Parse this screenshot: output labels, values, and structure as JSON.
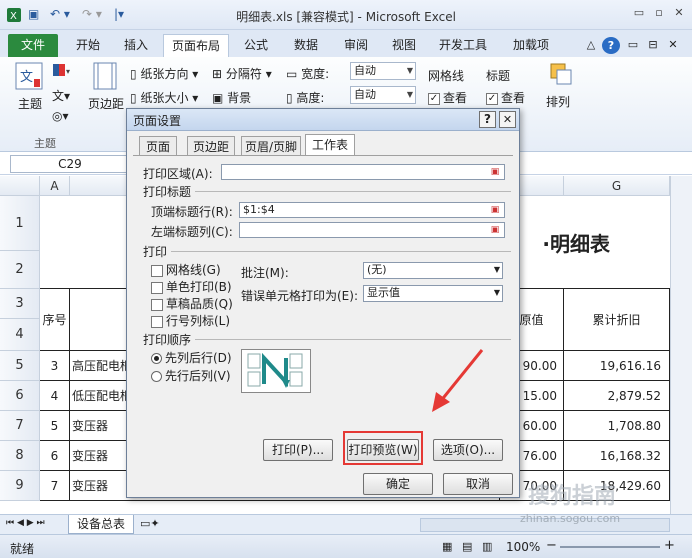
{
  "window": {
    "title": "明细表.xls  [兼容模式]  -  Microsoft Excel",
    "min": "▭",
    "max": "▫",
    "close": "✕"
  },
  "qat": {
    "save": "▣",
    "undo": "↶ ▾",
    "redo": "↷ ▾",
    "customize": "|▾"
  },
  "tabs": [
    "文件",
    "开始",
    "插入",
    "页面布局",
    "公式",
    "数据",
    "审阅",
    "视图",
    "开发工具",
    "加载项"
  ],
  "tabs_right": {
    "collapse": "△",
    "help": "?",
    "restore": "▭",
    "mdi_min": "⊟",
    "mdi_close": "✕"
  },
  "ribbon": {
    "themes_label": "主题",
    "themes_group": "主题",
    "margins_label": "页边距",
    "orientation": "纸张方向",
    "size": "纸张大小",
    "breaks": "分隔符",
    "background": "背景",
    "width_label": "宽度:",
    "width_value": "自动",
    "height_label": "高度:",
    "height_value": "自动",
    "gridlines_label": "网格线",
    "gridlines_view": "查看",
    "headings_label": "标题",
    "headings_view": "查看",
    "arrange_label": "排列"
  },
  "formula_bar": {
    "name_box": "C29"
  },
  "grid": {
    "col_headers": [
      "A",
      "G"
    ],
    "row_numbers": [
      "1",
      "2",
      "3",
      "4",
      "5",
      "6",
      "7",
      "8",
      "9"
    ],
    "title_fragment": "·明细表",
    "header_no": "序号",
    "header_value_fragment": "原值",
    "header_accum": "累计折旧",
    "rows": [
      {
        "no": "3",
        "name": "高压配电柜",
        "value": "90.00",
        "accum": "19,616.16"
      },
      {
        "no": "4",
        "name": "低压配电柜",
        "value": "15.00",
        "accum": "2,879.52"
      },
      {
        "no": "5",
        "name": "变压器",
        "value": "60.00",
        "accum": "1,708.80"
      },
      {
        "no": "6",
        "name": "变压器",
        "value": "76.00",
        "accum": "16,168.32"
      },
      {
        "no": "7",
        "name": "变压器",
        "value": "70.00",
        "accum": "18,429.60"
      }
    ]
  },
  "sheet_tabs": {
    "active": "设备总表",
    "nav": "⏮ ◀ ▶ ⏭"
  },
  "status": {
    "ready": "就绪",
    "zoom": "100%",
    "minus": "−",
    "plus": "+"
  },
  "dialog": {
    "title": "页面设置",
    "help": "?",
    "close": "✕",
    "tabs": [
      "页面",
      "页边距",
      "页眉/页脚",
      "工作表"
    ],
    "print_area_label": "打印区域(A):",
    "print_area_value": "",
    "print_titles_section": "打印标题",
    "rows_repeat_label": "顶端标题行(R):",
    "rows_repeat_value": "$1:$4",
    "cols_repeat_label": "左端标题列(C):",
    "cols_repeat_value": "",
    "print_section": "打印",
    "gridlines": "网格线(G)",
    "bw": "单色打印(B)",
    "draft": "草稿品质(Q)",
    "rowcol_headings": "行号列标(L)",
    "comments_label": "批注(M):",
    "comments_value": "(无)",
    "errors_label": "错误单元格打印为(E):",
    "errors_value": "显示值",
    "page_order_section": "打印顺序",
    "down_then_over": "先列后行(D)",
    "over_then_down": "先行后列(V)",
    "print_btn": "打印(P)...",
    "preview_btn": "打印预览(W)",
    "options_btn": "选项(O)...",
    "ok_btn": "确定",
    "cancel_btn": "取消"
  },
  "watermark": {
    "brand": "搜狗指南",
    "url": "zhinan.sogou.com"
  },
  "colors": {
    "file_tab": "#2b8a3e",
    "highlight": "#e53935",
    "arrow": "#e53935"
  }
}
